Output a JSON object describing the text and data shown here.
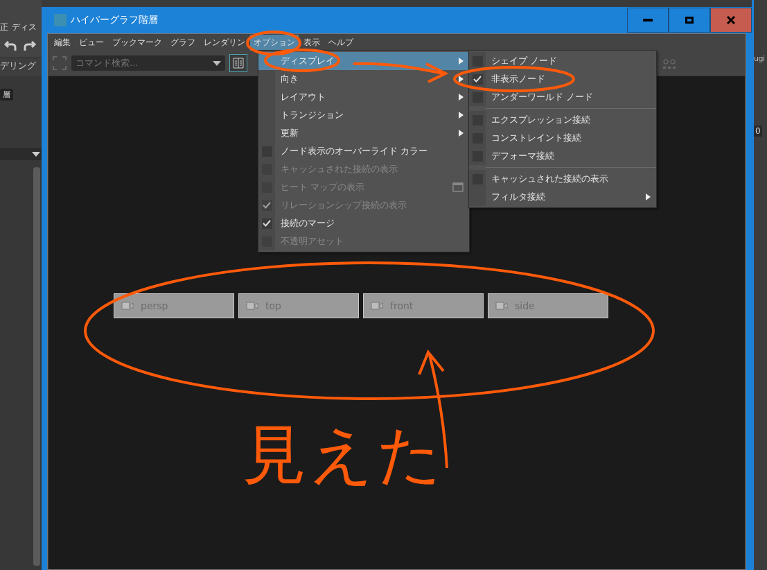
{
  "background_app": {
    "menu": [
      "正",
      "ディス"
    ],
    "tab": "デリング",
    "badge": "層",
    "right_label": "ugi",
    "right_field": "0"
  },
  "window": {
    "title": "ハイパーグラフ階層"
  },
  "menubar": [
    {
      "label": "編集",
      "selected": false
    },
    {
      "label": "ビュー",
      "selected": false
    },
    {
      "label": "ブックマーク",
      "selected": false
    },
    {
      "label": "グラフ",
      "selected": false
    },
    {
      "label": "レンダリン",
      "selected": false
    },
    {
      "label": "オプション",
      "selected": true
    },
    {
      "label": "表示",
      "selected": false
    },
    {
      "label": "ヘルプ",
      "selected": false
    }
  ],
  "toolbar": {
    "search_placeholder": "コマンド検索..."
  },
  "options_menu": [
    {
      "kind": "submenu",
      "label": "ディスプレイ",
      "selected": true
    },
    {
      "kind": "submenu",
      "label": "向き",
      "selected": false
    },
    {
      "kind": "submenu",
      "label": "レイアウト",
      "selected": false
    },
    {
      "kind": "submenu",
      "label": "トランジション",
      "selected": false
    },
    {
      "kind": "submenu",
      "label": "更新",
      "selected": false
    },
    {
      "kind": "check",
      "label": "ノード表示のオーバーライド カラー",
      "checked": false,
      "disabled": false,
      "option_box": false
    },
    {
      "kind": "check",
      "label": "キャッシュされた接続の表示",
      "checked": false,
      "disabled": true,
      "option_box": false
    },
    {
      "kind": "check",
      "label": "ヒート マップの表示",
      "checked": false,
      "disabled": true,
      "option_box": true
    },
    {
      "kind": "check",
      "label": "リレーションシップ接続の表示",
      "checked": true,
      "disabled": true,
      "option_box": false
    },
    {
      "kind": "check",
      "label": "接続のマージ",
      "checked": true,
      "disabled": false,
      "option_box": false
    },
    {
      "kind": "check",
      "label": "不透明アセット",
      "checked": false,
      "disabled": true,
      "option_box": false
    }
  ],
  "display_submenu": [
    {
      "kind": "check",
      "label": "シェイプ ノード",
      "checked": false
    },
    {
      "kind": "check",
      "label": "非表示ノード",
      "checked": true
    },
    {
      "kind": "check",
      "label": "アンダーワールド ノード",
      "checked": false
    },
    {
      "kind": "separator"
    },
    {
      "kind": "check",
      "label": "エクスプレッション接続",
      "checked": false
    },
    {
      "kind": "check",
      "label": "コンストレイント接続",
      "checked": false
    },
    {
      "kind": "check",
      "label": "デフォーマ接続",
      "checked": false
    },
    {
      "kind": "separator"
    },
    {
      "kind": "check",
      "label": "キャッシュされた接続の表示",
      "checked": false
    },
    {
      "kind": "submenu",
      "label": "フィルタ接続"
    }
  ],
  "nodes": [
    {
      "label": "persp"
    },
    {
      "label": "top"
    },
    {
      "label": "front"
    },
    {
      "label": "side"
    }
  ],
  "annotation": {
    "text": "見えた"
  }
}
